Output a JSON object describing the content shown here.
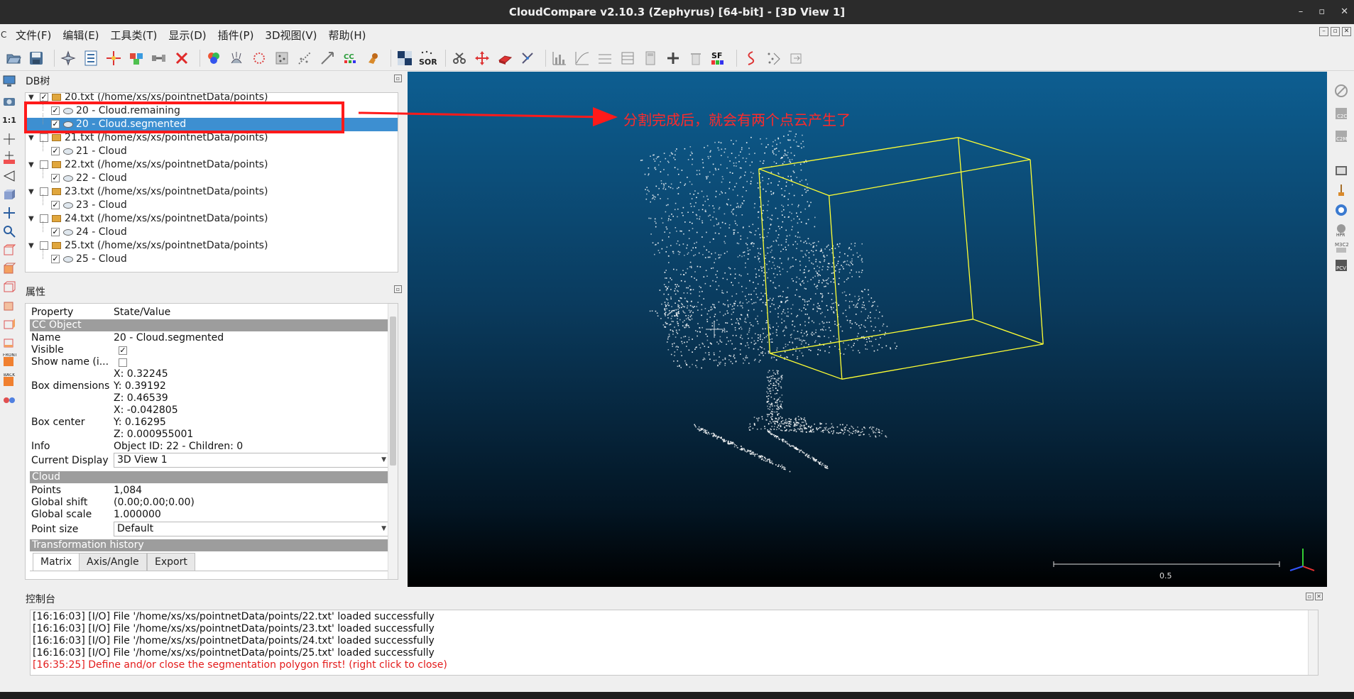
{
  "window": {
    "title": "CloudCompare v2.10.3 (Zephyrus) [64-bit] - [3D View 1]",
    "controls": [
      "–",
      "▫",
      "✕"
    ]
  },
  "menu": {
    "app_glyph": "C",
    "items": [
      "文件(F)",
      "编辑(E)",
      "工具类(T)",
      "显示(D)",
      "插件(P)",
      "3D视图(V)",
      "帮助(H)"
    ]
  },
  "toolbar": {
    "icons": [
      "open-icon",
      "save-icon",
      "sep",
      "global-shift-icon",
      "properties-icon",
      "segment-icon",
      "merge-icon",
      "plane-icon",
      "delete-icon",
      "sep",
      "color-icon",
      "normals-icon",
      "octree-icon",
      "sample-icon",
      "subsample-icon",
      "registration-icon",
      "cc-icon",
      "brush-icon",
      "sep",
      "gradient-icon",
      "sor-icon",
      "sep",
      "scissors-icon",
      "translate-icon",
      "rotate-icon",
      "pick-icon",
      "sep",
      "histogram-icon",
      "fit-icon",
      "minmax-icon",
      "filter-icon",
      "calc-icon",
      "add-icon",
      "delete2-icon",
      "sf-icon",
      "sep",
      "curve-icon",
      "noise-icon",
      "export-icon"
    ],
    "sor_label": "SOR",
    "cc_label": "CC",
    "sf_label": "SF"
  },
  "db_tree": {
    "title": "DB树",
    "items": [
      {
        "level": 0,
        "label": "20.txt (/home/xs/xs/pointnetData/points)",
        "checked": true,
        "selected": false
      },
      {
        "level": 1,
        "label": "20 - Cloud.remaining",
        "checked": true,
        "selected": false
      },
      {
        "level": 1,
        "label": "20 - Cloud.segmented",
        "checked": true,
        "selected": true
      },
      {
        "level": 0,
        "label": "21.txt (/home/xs/xs/pointnetData/points)",
        "checked": false,
        "selected": false
      },
      {
        "level": 1,
        "label": "21 - Cloud",
        "checked": true,
        "selected": false
      },
      {
        "level": 0,
        "label": "22.txt (/home/xs/xs/pointnetData/points)",
        "checked": false,
        "selected": false
      },
      {
        "level": 1,
        "label": "22 - Cloud",
        "checked": true,
        "selected": false
      },
      {
        "level": 0,
        "label": "23.txt (/home/xs/xs/pointnetData/points)",
        "checked": false,
        "selected": false
      },
      {
        "level": 1,
        "label": "23 - Cloud",
        "checked": true,
        "selected": false
      },
      {
        "level": 0,
        "label": "24.txt (/home/xs/xs/pointnetData/points)",
        "checked": false,
        "selected": false
      },
      {
        "level": 1,
        "label": "24 - Cloud",
        "checked": true,
        "selected": false
      },
      {
        "level": 0,
        "label": "25.txt (/home/xs/xs/pointnetData/points)",
        "checked": false,
        "selected": false
      },
      {
        "level": 1,
        "label": "25 - Cloud",
        "checked": true,
        "selected": false
      }
    ]
  },
  "properties": {
    "title": "属性",
    "header_property": "Property",
    "header_value": "State/Value",
    "section_cc_object": "CC Object",
    "name_key": "Name",
    "name_value": "20 - Cloud.segmented",
    "visible_key": "Visible",
    "show_name_key": "Show name (i...",
    "box_dim_key": "Box dimensions",
    "box_dim_x": "X: 0.32245",
    "box_dim_y": "Y: 0.39192",
    "box_dim_z": "Z: 0.46539",
    "box_center_key": "Box center",
    "box_center_x": "X: -0.042805",
    "box_center_y": "Y: 0.16295",
    "box_center_z": "Z: 0.000955001",
    "info_key": "Info",
    "info_value": "Object ID: 22 - Children: 0",
    "current_display_key": "Current Display",
    "current_display_value": "3D View 1",
    "section_cloud": "Cloud",
    "points_key": "Points",
    "points_value": "1,084",
    "global_shift_key": "Global shift",
    "global_shift_value": "(0.00;0.00;0.00)",
    "global_scale_key": "Global scale",
    "global_scale_value": "1.000000",
    "point_size_key": "Point size",
    "point_size_value": "Default",
    "section_transform": "Transformation history",
    "tabs": [
      "Matrix",
      "Axis/Angle",
      "Export"
    ],
    "visible_checked": true,
    "show_name_checked": false
  },
  "view3d": {
    "scale_label": "0.5",
    "point_color": "#ffffff",
    "bbox_color": "#ffff33"
  },
  "annotation": {
    "text": "分割完成后，就会有两个点云产生了",
    "color": "#ff1a1a"
  },
  "console": {
    "title": "控制台",
    "lines": [
      {
        "text": "[16:16:03] [I/O] File '/home/xs/xs/pointnetData/points/22.txt' loaded successfully",
        "error": false
      },
      {
        "text": "[16:16:03] [I/O] File '/home/xs/xs/pointnetData/points/23.txt' loaded successfully",
        "error": false
      },
      {
        "text": "[16:16:03] [I/O] File '/home/xs/xs/pointnetData/points/24.txt' loaded successfully",
        "error": false
      },
      {
        "text": "[16:16:03] [I/O] File '/home/xs/xs/pointnetData/points/25.txt' loaded successfully",
        "error": false
      },
      {
        "text": "[16:35:25] Define and/or close the segmentation polygon first! (right click to close)",
        "error": true
      }
    ]
  }
}
